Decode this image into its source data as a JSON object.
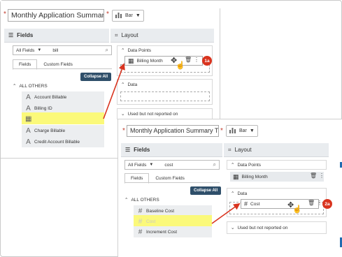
{
  "screen1": {
    "title_required_mark": "*",
    "title_value": "Monthly Application Summary Tren",
    "title_required_mark2": "*",
    "chart_type": "Bar",
    "fields_header": "Fields",
    "layout_header": "Layout",
    "search": {
      "filter": "All Fields",
      "query": "bill"
    },
    "tabs": [
      "Fields",
      "Custom Fields"
    ],
    "collapse_all": "Collapse All",
    "group": "ALL OTHERS",
    "fields": [
      {
        "label": "Account Billable",
        "icon": "text-icon"
      },
      {
        "label": "Billing ID",
        "icon": "text-icon"
      },
      {
        "label": "",
        "icon": "calendar-icon"
      },
      {
        "label": "Charge Billable",
        "icon": "text-icon"
      },
      {
        "label": "Credit Account Billable",
        "icon": "text-icon"
      }
    ],
    "sections": {
      "data_points": "Data Points",
      "data": "Data",
      "unused": "Used but not reported on"
    },
    "drag_pill": "Billing Month",
    "badge": "1a"
  },
  "screen2": {
    "title_required_mark": "*",
    "title_value": "Monthly Application Summary Tren",
    "title_required_mark2": "*",
    "chart_type": "Bar",
    "fields_header": "Fields",
    "layout_header": "Layout",
    "search": {
      "filter": "All Fields",
      "query": "cost"
    },
    "tabs": [
      "Fields",
      "Custom Fields"
    ],
    "collapse_all": "Collapse All",
    "group": "ALL OTHERS",
    "fields": [
      {
        "label": "Baseline Cost",
        "icon": "hash-icon"
      },
      {
        "label": "Cost",
        "icon": "hash-icon"
      },
      {
        "label": "Increment Cost",
        "icon": "hash-icon"
      }
    ],
    "sections": {
      "data_points": "Data Points",
      "data": "Data",
      "unused": "Used but not reported on"
    },
    "data_point_pill": "Billing Month",
    "drag_pill": "Cost",
    "badge": "2a"
  },
  "colors": {
    "highlight": "#fbf97a",
    "arrow": "#d9341f",
    "collapse_button": "#2f4f6a",
    "panel_header": "#e9ecef"
  }
}
